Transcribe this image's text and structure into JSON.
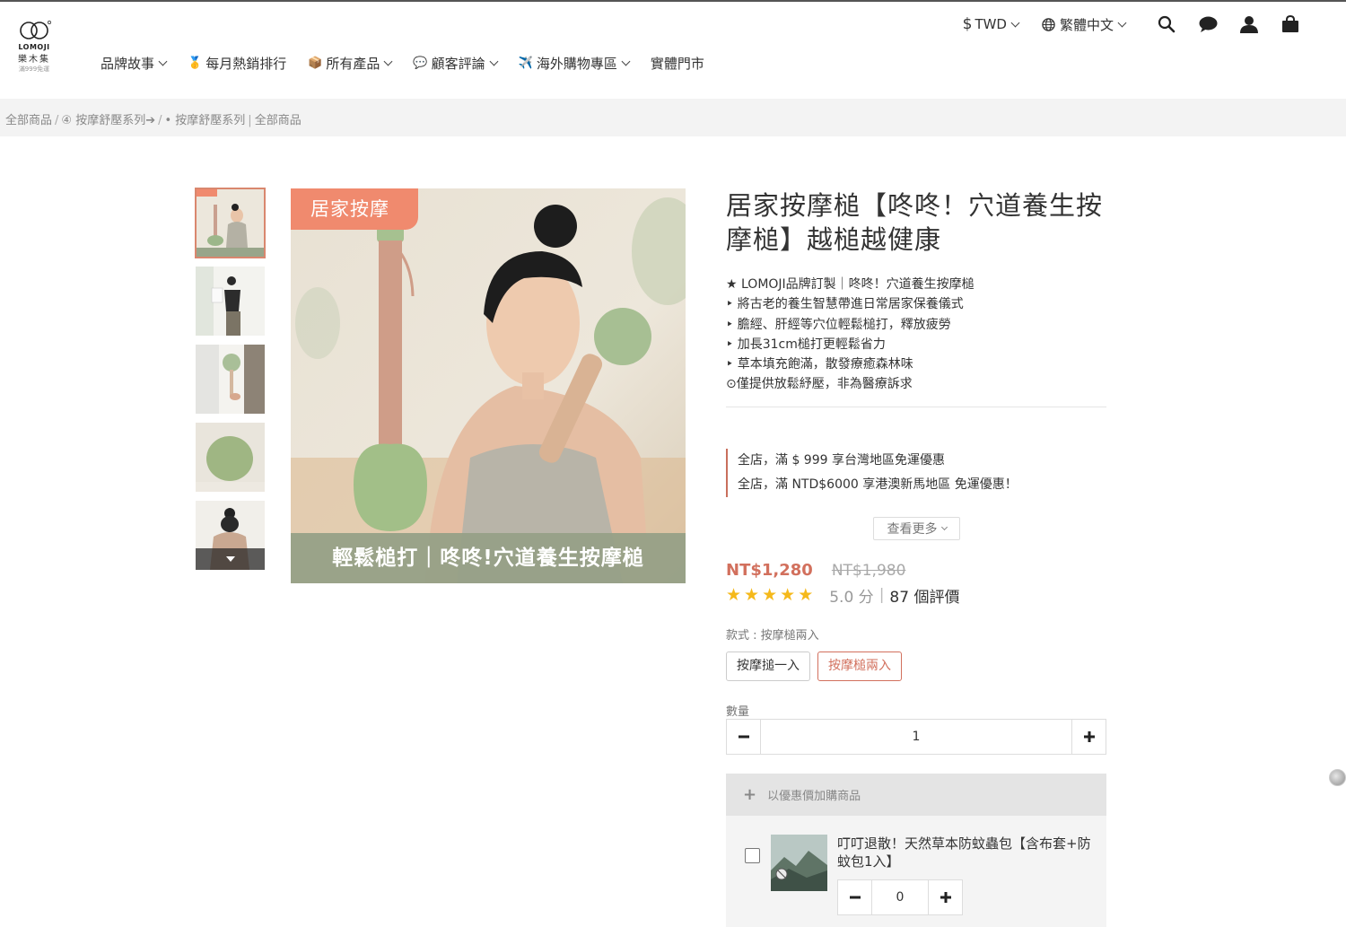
{
  "header": {
    "logo": {
      "brand": "LOMOJI",
      "chinese": "樂木集",
      "tagline": "滿999免運"
    },
    "util": {
      "currency": "TWD",
      "currency_symbol": "$",
      "language": "繁體中文"
    },
    "nav": [
      {
        "label": "品牌故事",
        "emoji": "",
        "dropdown": true
      },
      {
        "label": "每月熱銷排行",
        "emoji": "🥇",
        "dropdown": false
      },
      {
        "label": "所有產品",
        "emoji": "📦",
        "dropdown": true
      },
      {
        "label": "顧客評論",
        "emoji": "💬",
        "dropdown": true
      },
      {
        "label": "海外購物專區",
        "emoji": "✈️",
        "dropdown": true
      },
      {
        "label": "實體門市",
        "emoji": "",
        "dropdown": false
      }
    ]
  },
  "breadcrumb": {
    "items": [
      "全部商品",
      "④ 按摩舒壓系列➔",
      "• 按摩舒壓系列",
      "全部商品"
    ],
    "separators": [
      "/",
      "/",
      "|"
    ]
  },
  "gallery": {
    "badge": "居家按摩",
    "caption": "輕鬆槌打｜咚咚!穴道養生按摩槌"
  },
  "product": {
    "title": "居家按摩槌【咚咚！穴道養生按摩槌】越槌越健康",
    "description": [
      "★ LOMOJI品牌訂製｜咚咚！穴道養生按摩槌",
      "‣ 將古老的養生智慧帶進日常居家保養儀式",
      "‣ 膽經、肝經等穴位輕鬆槌打，釋放疲勞",
      "‣ 加長31cm槌打更輕鬆省力",
      "‣ 草本填充飽滿，散發療癒森林味",
      "⊙僅提供放鬆紓壓，非為醫療訴求"
    ],
    "promotions": [
      "全店，滿 $ 999 享台灣地區免運優惠",
      "全店，滿 NTD$6000 享港澳新馬地區 免運優惠！"
    ],
    "more_label": "查看更多",
    "price": "NT$1,280",
    "original_price": "NT$1,980",
    "rating": 5,
    "score_text": "5.0 分",
    "reviews_text": "87 個評價",
    "variant_label": "款式 : 按摩槌兩入",
    "variants": [
      "按摩搥一入",
      "按摩槌兩入"
    ],
    "selected_variant": 1,
    "quantity_label": "數量",
    "quantity": "1"
  },
  "addon": {
    "header": "以優惠價加購商品",
    "item_title": "叮叮退散！天然草本防蚊蟲包【含布套+防蚊包1入】",
    "item_quantity": "0"
  },
  "colors": {
    "accent": "#d2705d",
    "star": "#f5b91b",
    "badge": "#f08a6e"
  }
}
